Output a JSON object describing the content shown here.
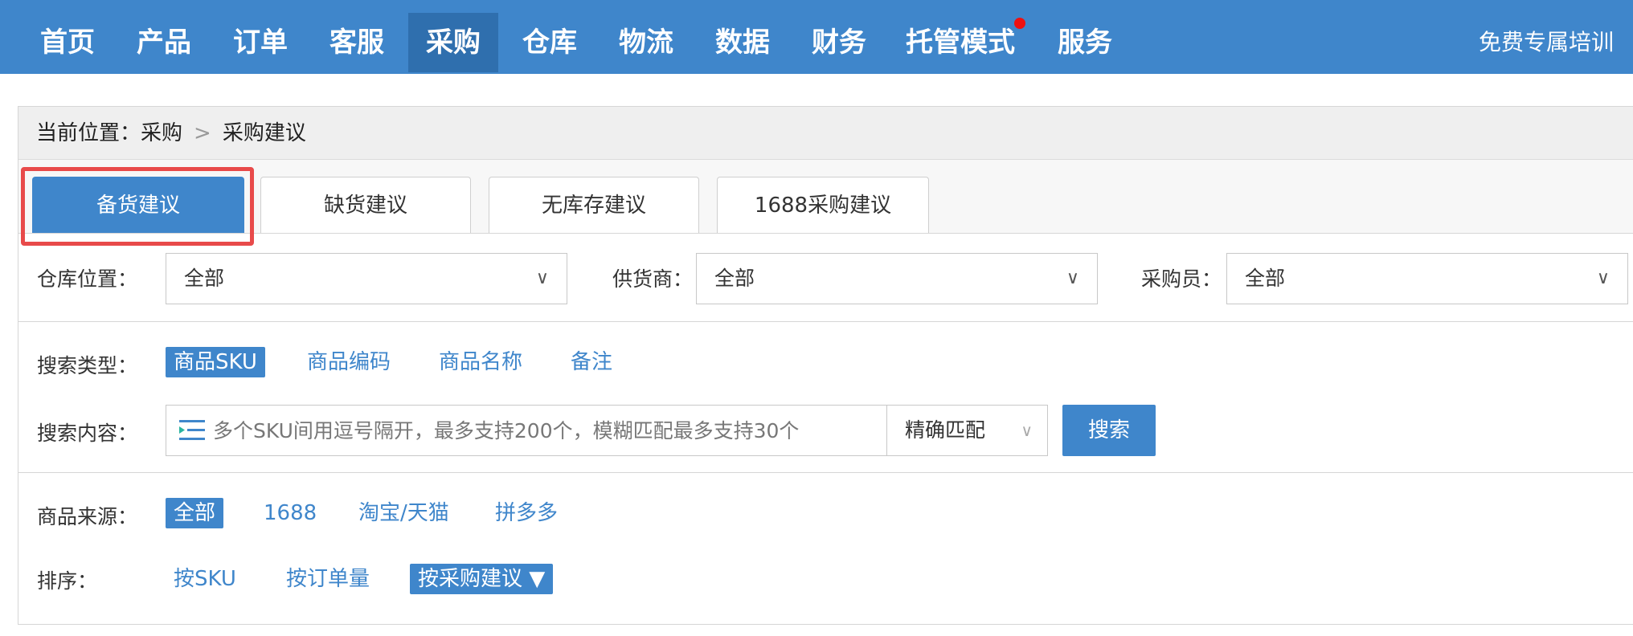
{
  "nav": {
    "items": [
      {
        "label": "首页",
        "active": false
      },
      {
        "label": "产品",
        "active": false
      },
      {
        "label": "订单",
        "active": false
      },
      {
        "label": "客服",
        "active": false
      },
      {
        "label": "采购",
        "active": true
      },
      {
        "label": "仓库",
        "active": false
      },
      {
        "label": "物流",
        "active": false
      },
      {
        "label": "数据",
        "active": false
      },
      {
        "label": "财务",
        "active": false
      },
      {
        "label": "托管模式",
        "active": false,
        "badge_dot": true
      },
      {
        "label": "服务",
        "active": false
      }
    ],
    "right_link": "免费专属培训"
  },
  "breadcrumb": {
    "prefix": "当前位置：",
    "level1": "采购",
    "separator": ">",
    "level2": "采购建议"
  },
  "tabs": [
    {
      "label": "备货建议",
      "active": true
    },
    {
      "label": "缺货建议",
      "active": false
    },
    {
      "label": "无库存建议",
      "active": false
    },
    {
      "label": "1688采购建议",
      "active": false
    }
  ],
  "filters": {
    "warehouse": {
      "label": "仓库位置：",
      "value": "全部"
    },
    "supplier": {
      "label": "供货商：",
      "value": "全部"
    },
    "buyer": {
      "label": "采购员：",
      "value": "全部"
    }
  },
  "search_type": {
    "label": "搜索类型：",
    "options": [
      {
        "label": "商品SKU",
        "selected": true
      },
      {
        "label": "商品编码",
        "selected": false
      },
      {
        "label": "商品名称",
        "selected": false
      },
      {
        "label": "备注",
        "selected": false
      }
    ]
  },
  "search_content": {
    "label": "搜索内容：",
    "placeholder": "多个SKU间用逗号隔开，最多支持200个，模糊匹配最多支持30个",
    "match_mode": "精确匹配",
    "button": "搜索"
  },
  "source": {
    "label": "商品来源：",
    "options": [
      {
        "label": "全部",
        "selected": true
      },
      {
        "label": "1688",
        "selected": false
      },
      {
        "label": "淘宝/天猫",
        "selected": false
      },
      {
        "label": "拼多多",
        "selected": false
      }
    ]
  },
  "sort": {
    "label": "排序：",
    "options": [
      {
        "label": "按SKU",
        "selected": false
      },
      {
        "label": "按订单量",
        "selected": false
      },
      {
        "label": "按采购建议 ▼",
        "selected": true
      }
    ]
  },
  "colors": {
    "primary": "#3f86cb",
    "nav_active": "#2f6fae",
    "highlight": "#e84a4a",
    "badge": "#ee1111"
  }
}
